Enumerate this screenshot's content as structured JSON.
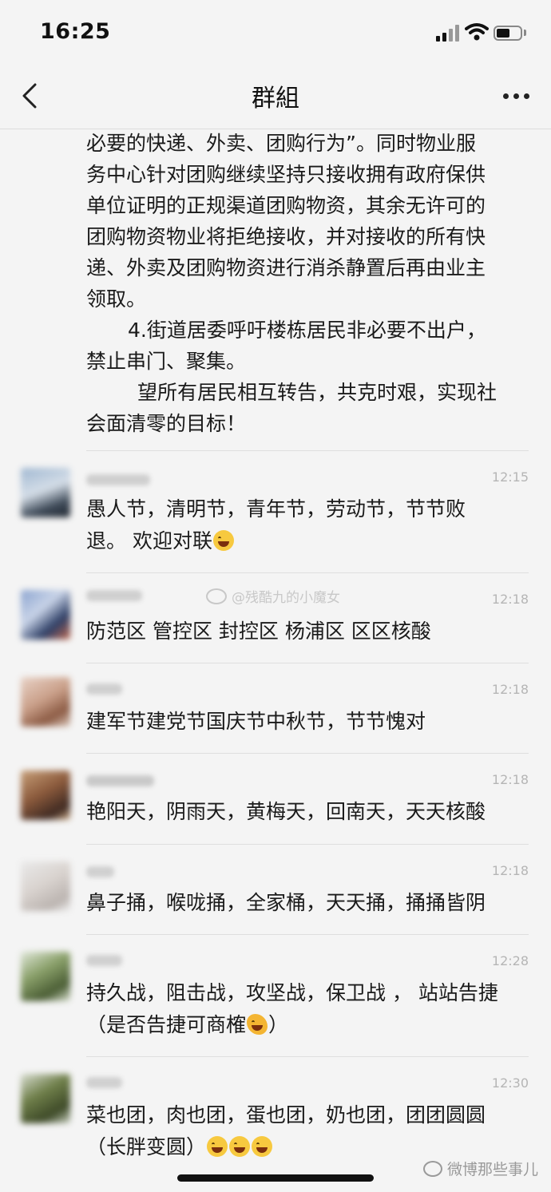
{
  "status_bar": {
    "time": "16:25",
    "icons": [
      "cellular-signal-icon",
      "wifi-icon",
      "battery-icon"
    ]
  },
  "nav": {
    "title": "群組",
    "back_icon": "chevron-left-icon",
    "more_icon": "more-dots-icon"
  },
  "notice": {
    "lines": [
      "必要的快递、外卖、团购行为”。同时物业服",
      "务中心针对团购继续坚持只接收拥有政府保供",
      "单位证明的正规渠道团购物资，其余无许可的",
      "团购物资物业将拒绝接收，并对接收的所有快",
      "递、外卖及团购物资进行消杀静置后再由业主",
      "领取。",
      "4.街道居委呼吁楼栋居民非必要不出户，",
      "禁止串门、聚集。",
      "望所有居民相互转告，共克时艰，实现社",
      "会面清零的目标！"
    ]
  },
  "watermark": "@残酷九的小魔女",
  "messages": [
    {
      "time": "12:15",
      "lines": [
        "愚人节，清明节，青年节，劳动节，节节败",
        "退。 欢迎对联"
      ],
      "emoji": "grin-sweat"
    },
    {
      "time": "12:18",
      "lines": [
        "防范区 管控区 封控区 杨浦区 区区核酸"
      ]
    },
    {
      "time": "12:18",
      "lines": [
        "建军节建党节国庆节中秋节，节节愧对"
      ]
    },
    {
      "time": "12:18",
      "lines": [
        "艳阳天，阴雨天，黄梅天，回南天，天天核酸"
      ]
    },
    {
      "time": "12:18",
      "lines": [
        "鼻子捅，喉咙捅，全家桶，天天捅，捅捅皆阴"
      ]
    },
    {
      "time": "12:28",
      "lines": [
        "持久战，阻击战，攻坚战，保卫战 ， 站站告捷",
        "（是否告捷可商榷"
      ],
      "emoji": "clap",
      "suffix": "）"
    },
    {
      "time": "12:30",
      "lines": [
        "菜也团，肉也团，蛋也团，奶也团，团团圆圆",
        "（长胖变圆）"
      ],
      "emoji": "grin-sweat-x3"
    }
  ],
  "footer_watermark": "微博那些事儿",
  "colors": {
    "background": "#f4f4f4",
    "time_gray": "#b5b5b5",
    "divider": "#dedede"
  }
}
